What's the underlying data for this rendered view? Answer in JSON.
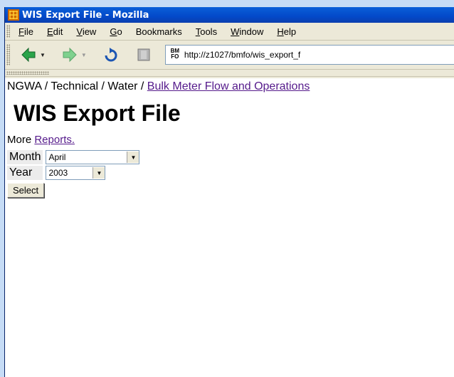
{
  "window": {
    "title": "WIS Export File - Mozilla"
  },
  "menubar": {
    "items": [
      {
        "label": "File",
        "key": "F"
      },
      {
        "label": "Edit",
        "key": "E"
      },
      {
        "label": "View",
        "key": "V"
      },
      {
        "label": "Go",
        "key": "G"
      },
      {
        "label": "Bookmarks",
        "key": ""
      },
      {
        "label": "Tools",
        "key": "T"
      },
      {
        "label": "Window",
        "key": "W"
      },
      {
        "label": "Help",
        "key": "H"
      }
    ]
  },
  "navbar": {
    "url": "http://z1027/bmfo/wis_export_f",
    "site_badge_top": "BM",
    "site_badge_bottom": "FO"
  },
  "page": {
    "breadcrumb": {
      "prefix": "NGWA / Technical / Water / ",
      "link": "Bulk Meter Flow and Operations"
    },
    "title": "WIS Export File",
    "more_prefix": "More ",
    "more_link": "Reports.",
    "form": {
      "month_label": "Month",
      "month_value": "April",
      "year_label": "Year",
      "year_value": "2003",
      "select_button": "Select"
    }
  },
  "colors": {
    "titlebar": "#0a5fd8",
    "visited_link": "#551a8b"
  }
}
